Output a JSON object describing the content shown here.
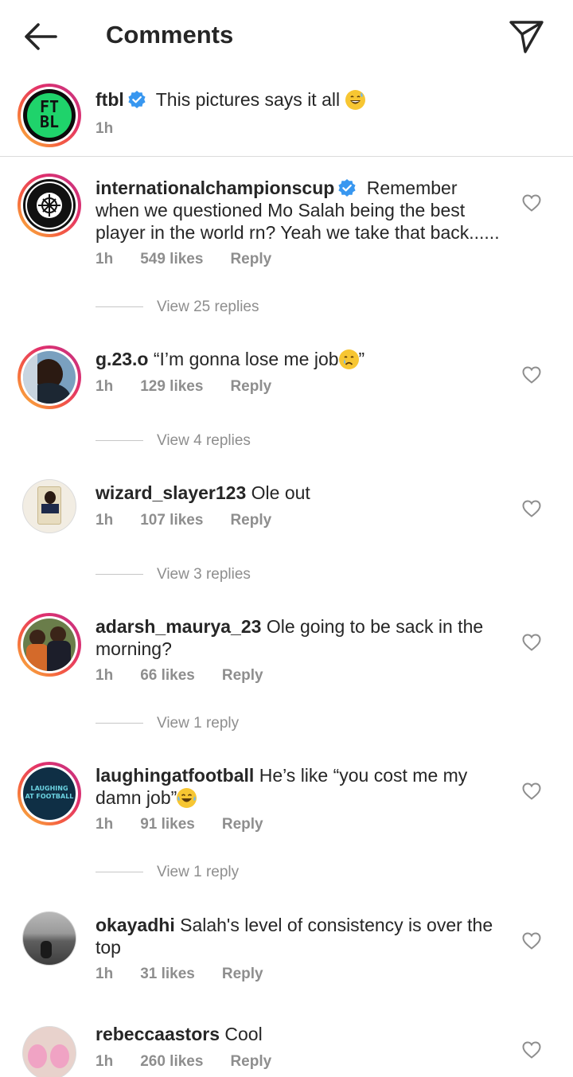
{
  "header": {
    "title": "Comments"
  },
  "caption": {
    "username": "ftbl",
    "text": "This pictures says it all",
    "time": "1h",
    "avatar_text_top": "FT",
    "avatar_text_bottom": "BL"
  },
  "comments": [
    {
      "username": "internationalchampionscup",
      "verified": true,
      "text": "Remember when we questioned Mo Salah being the best player in the world rn? Yeah we take that back......",
      "time": "1h",
      "likes": "549 likes",
      "reply": "Reply",
      "view_replies": "View 25 replies",
      "avatar_text_top": "INTERNATIONAL",
      "avatar_text_bottom": "CHAMPIONS CUP"
    },
    {
      "username": "g.23.o",
      "text": "“I’m gonna lose me job",
      "text_end": "”",
      "time": "1h",
      "likes": "129 likes",
      "reply": "Reply",
      "view_replies": "View 4 replies"
    },
    {
      "username": "wizard_slayer123",
      "text": "Ole out",
      "time": "1h",
      "likes": "107 likes",
      "reply": "Reply",
      "view_replies": "View 3 replies"
    },
    {
      "username": "adarsh_maurya_23",
      "text": "Ole going to be sack in the morning?",
      "time": "1h",
      "likes": "66 likes",
      "reply": "Reply",
      "view_replies": "View 1 reply"
    },
    {
      "username": "laughingatfootball",
      "text": "He’s like “you cost me my damn job”",
      "time": "1h",
      "likes": "91 likes",
      "reply": "Reply",
      "view_replies": "View 1 reply",
      "avatar_text_top": "LAUGHING",
      "avatar_text_bottom": "AT FOOTBALL"
    },
    {
      "username": "okayadhi",
      "text": "Salah's level of consistency is over the top",
      "time": "1h",
      "likes": "31 likes",
      "reply": "Reply"
    },
    {
      "username": "rebeccaastors",
      "text": "Cool",
      "time": "1h",
      "likes": "260 likes",
      "reply": "Reply"
    }
  ],
  "colors": {
    "text": "#262626",
    "secondary": "#8e8e8e",
    "verified": "#3897f0",
    "ring_gradient": [
      "#f9c33d",
      "#e1306c",
      "#c13584"
    ]
  },
  "icons": [
    "back-arrow-icon",
    "send-icon",
    "verified-icon",
    "heart-icon",
    "emoji-icon"
  ]
}
